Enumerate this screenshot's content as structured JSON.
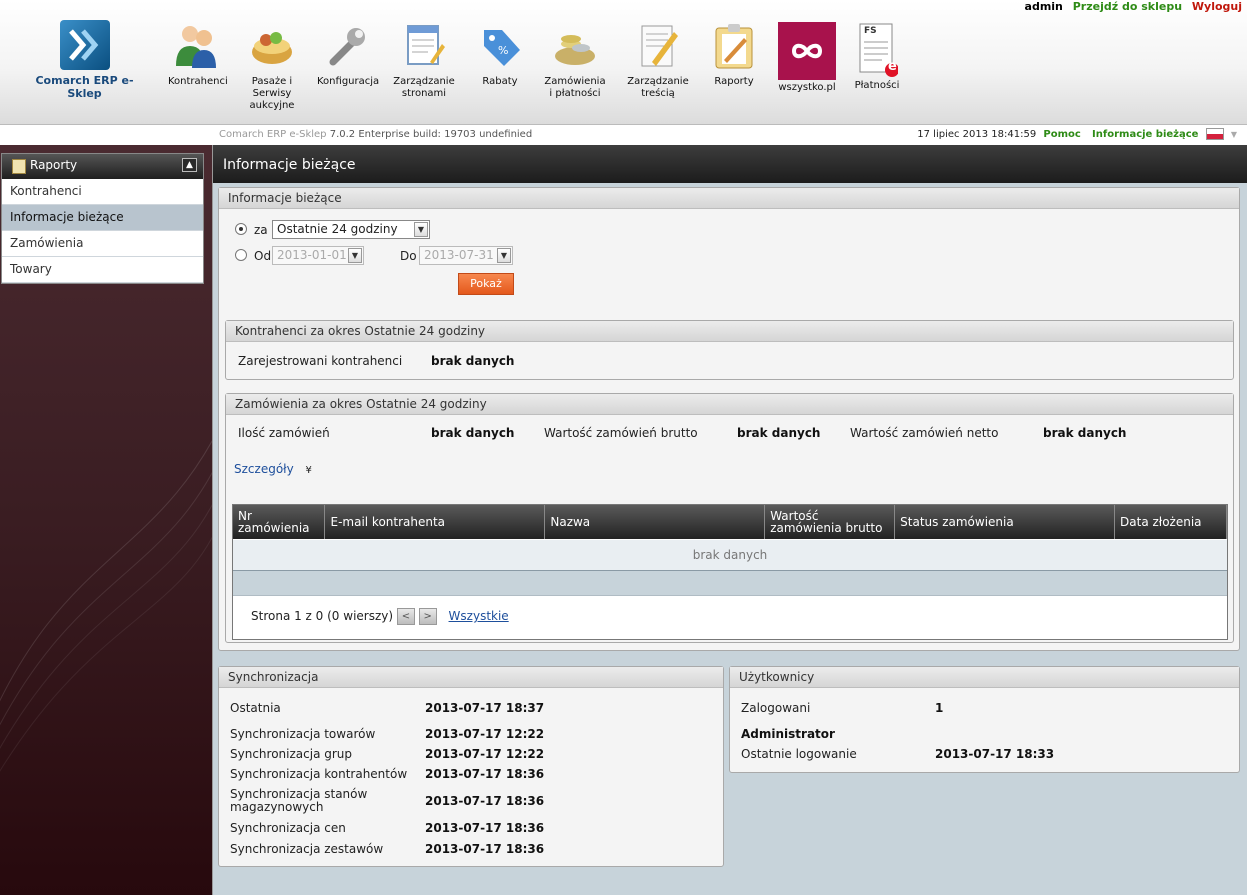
{
  "top_links": {
    "user": "admin",
    "shop": "Przejdź do sklepu",
    "logout": "Wyloguj"
  },
  "logo": {
    "text": "Comarch ERP e-Sklep"
  },
  "modules": [
    {
      "label": "Kontrahenci",
      "icon": "users-icon"
    },
    {
      "label": "Pasaże i Serwisy aukcyjne",
      "icon": "basket-icon"
    },
    {
      "label": "Konfiguracja",
      "icon": "wrench-icon"
    },
    {
      "label": "Zarządzanie stronami",
      "icon": "pages-icon"
    },
    {
      "label": "Rabaty",
      "icon": "discount-tag-icon"
    },
    {
      "label": "Zamówienia i płatności",
      "icon": "coins-basket-icon"
    },
    {
      "label": "Zarządzanie treścią",
      "icon": "content-edit-icon"
    },
    {
      "label": "Raporty",
      "icon": "reports-icon"
    },
    {
      "label": "wszystko.pl",
      "icon": "wszystko-logo-icon"
    },
    {
      "label": "Płatności",
      "icon": "invoice-icon",
      "icon_text": "FS",
      "icon_badge": "e"
    }
  ],
  "status": {
    "product": "Comarch ERP e-Sklep",
    "version": "7.0.2 Enterprise build: 19703  undefinied",
    "datetime": "17 lipiec 2013 18:41:59",
    "help": "Pomoc",
    "current_info": "Informacje bieżące"
  },
  "sidebar": {
    "title": "Raporty",
    "items": [
      {
        "label": "Kontrahenci",
        "active": false
      },
      {
        "label": "Informacje bieżące",
        "active": true
      },
      {
        "label": "Zamówienia",
        "active": false
      },
      {
        "label": "Towary",
        "active": false
      }
    ]
  },
  "main": {
    "title": "Informacje bieżące",
    "filter": {
      "header": "Informacje bieżące",
      "za_label": "za",
      "za_value": "Ostatnie 24 godziny",
      "od_label": "Od",
      "od_value": "2013-01-01",
      "do_label": "Do",
      "do_value": "2013-07-31",
      "show_button": "Pokaż"
    },
    "clients": {
      "header": "Kontrahenci za okres Ostatnie 24 godziny",
      "registered_label": "Zarejestrowani kontrahenci",
      "registered_value": "brak danych"
    },
    "orders": {
      "header": "Zamówienia za okres Ostatnie 24 godziny",
      "count_label": "Ilość zamówień",
      "count_value": "brak danych",
      "gross_label": "Wartość zamówień brutto",
      "gross_value": "brak danych",
      "net_label": "Wartość zamówień netto",
      "net_value": "brak danych",
      "details_link": "Szczegóły",
      "columns": [
        "Nr zamówienia",
        "E-mail kontrahenta",
        "Nazwa",
        "Wartość zamówienia brutto",
        "Status zamówienia",
        "Data złożenia"
      ],
      "empty": "brak danych",
      "pager_text": "Strona 1 z 0 (0 wierszy)",
      "all_link": "Wszystkie"
    },
    "sync": {
      "header": "Synchronizacja",
      "rows": [
        {
          "label": "Ostatnia",
          "value": "2013-07-17 18:37"
        },
        {
          "label": "Synchronizacja towarów",
          "value": "2013-07-17 12:22"
        },
        {
          "label": "Synchronizacja grup",
          "value": "2013-07-17 12:22"
        },
        {
          "label": "Synchronizacja kontrahentów",
          "value": "2013-07-17 18:36"
        },
        {
          "label": "Synchronizacja stanów magazynowych",
          "value": "2013-07-17 18:36"
        },
        {
          "label": "Synchronizacja cen",
          "value": "2013-07-17 18:36"
        },
        {
          "label": "Synchronizacja zestawów",
          "value": "2013-07-17 18:36"
        }
      ]
    },
    "users": {
      "header": "Użytkownicy",
      "logged_label": "Zalogowani",
      "logged_value": "1",
      "admin_name": "Administrator",
      "last_login_label": "Ostatnie logowanie",
      "last_login_value": "2013-07-17 18:33"
    }
  }
}
